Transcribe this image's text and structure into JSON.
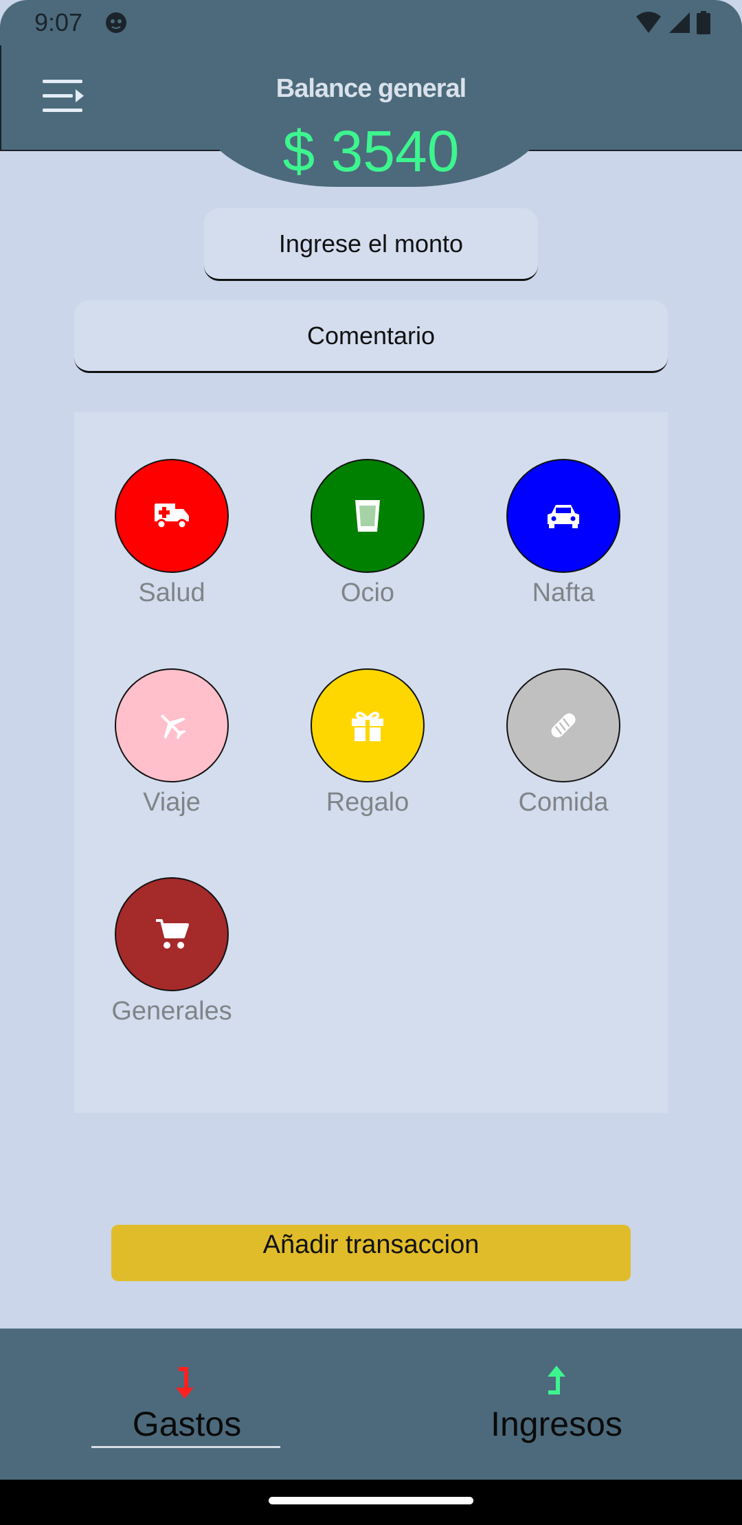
{
  "status_bar": {
    "time": "9:07"
  },
  "header": {
    "menu_icon": "menu-open-icon",
    "title": "Balance general",
    "balance": "$ 3540",
    "balance_color": "#3df58f",
    "bar_color": "#4c6a7c"
  },
  "form": {
    "amount_placeholder": "Ingrese el monto",
    "comment_placeholder": "Comentario"
  },
  "categories": [
    {
      "label": "Salud",
      "color": "#ff0000",
      "icon": "ambulance-icon"
    },
    {
      "label": "Ocio",
      "color": "#008000",
      "icon": "drink-icon"
    },
    {
      "label": "Nafta",
      "color": "#0000ff",
      "icon": "car-icon"
    },
    {
      "label": "Viaje",
      "color": "#ffc0cb",
      "icon": "plane-icon"
    },
    {
      "label": "Regalo",
      "color": "#ffd700",
      "icon": "gift-icon"
    },
    {
      "label": "Comida",
      "color": "#c0c0c0",
      "icon": "bread-icon"
    },
    {
      "label": "Generales",
      "color": "#a52a2a",
      "icon": "cart-icon"
    }
  ],
  "add_button": {
    "label": "Añadir transaccion",
    "color": "#e0bc2a"
  },
  "bottom_nav": {
    "tabs": [
      {
        "label": "Gastos",
        "icon": "arrow-down-icon",
        "icon_color": "#ff2020",
        "selected": true
      },
      {
        "label": "Ingresos",
        "icon": "arrow-up-icon",
        "icon_color": "#3df58f",
        "selected": false
      }
    ]
  }
}
